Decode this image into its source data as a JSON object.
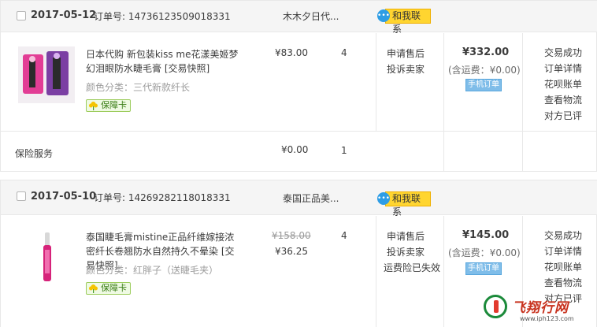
{
  "orders": [
    {
      "date": "2017-05-12",
      "order_no": "订单号: 14736123509018331",
      "shop": "木木夕日代...",
      "contact": "和我联系",
      "item": {
        "title": "日本代购 新包装kiss me花漾美姬梦幻泪眼防水睫毛膏 [交易快照]",
        "spec": "颜色分类：三代新款纤长",
        "badge": "保障卡",
        "price": "¥83.00",
        "qty": "4",
        "service": [
          "申请售后",
          "投诉卖家"
        ]
      },
      "total": "¥332.00",
      "shipping": "(含运费：¥0.00)",
      "mobile": "手机订单",
      "actions": [
        "交易成功",
        "订单详情",
        "花呗账单",
        "查看物流",
        "对方已评"
      ],
      "insurance": {
        "label": "保险服务",
        "price": "¥0.00",
        "qty": "1"
      }
    },
    {
      "date": "2017-05-10",
      "order_no": "订单号: 14269282118018331",
      "shop": "泰国正品美...",
      "contact": "和我联系",
      "item": {
        "title": "泰国睫毛膏mistine正品纤维嫁接浓密纤长卷翘防水自然持久不晕染 [交易快照]",
        "spec": "颜色分类：红胖子（送睫毛夹）",
        "badge": "保障卡",
        "original_price": "¥158.00",
        "price": "¥36.25",
        "qty": "4",
        "service": [
          "申请售后",
          "投诉卖家",
          "运费险已失效"
        ]
      },
      "total": "¥145.00",
      "shipping": "(含运费：¥0.00)",
      "mobile": "手机订单",
      "actions": [
        "交易成功",
        "订单详情",
        "花呗账单",
        "查看物流",
        "对方已评"
      ]
    }
  ],
  "watermark": {
    "name": "飞翔行网",
    "url": "www.iph123.com"
  }
}
